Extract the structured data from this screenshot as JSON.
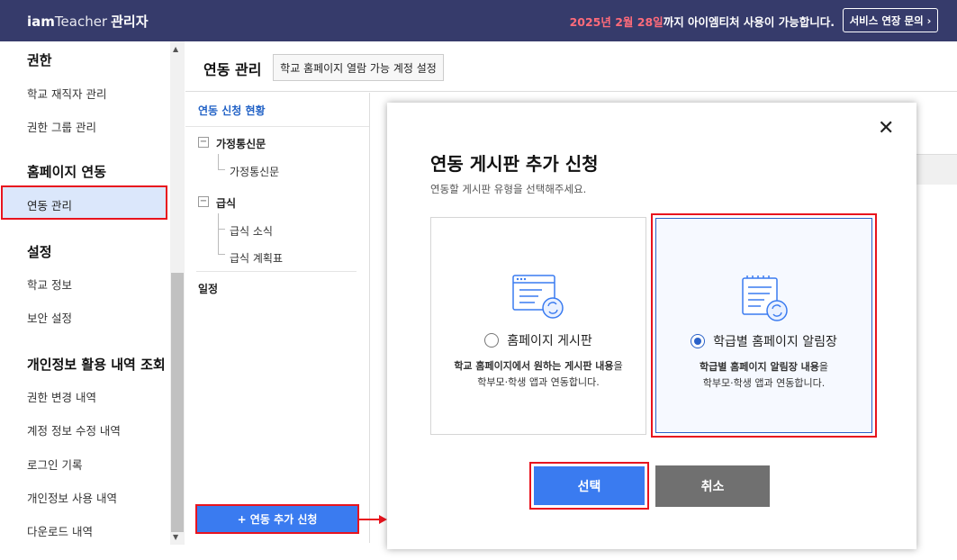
{
  "topbar": {
    "logo_brand": "iam",
    "logo_product": "Teacher",
    "logo_admin": "관리자",
    "notice_highlight": "2025년 2월 28일",
    "notice_rest": "까지 아이엠티처 사용이 가능합니다.",
    "service_button": "서비스 연장 문의 ›"
  },
  "sidebar": {
    "sections": [
      {
        "heading": "권한",
        "items": [
          "학교 재직자 관리",
          "권한 그룹 관리"
        ]
      },
      {
        "heading": "홈페이지 연동",
        "items": [
          "연동 관리"
        ]
      },
      {
        "heading": "설정",
        "items": [
          "학교 정보",
          "보안 설정"
        ]
      },
      {
        "heading": "개인정보 활용 내역 조회",
        "items": [
          "권한 변경 내역",
          "계정 정보 수정 내역",
          "로그인 기록",
          "개인정보 사용 내역",
          "다운로드 내역"
        ]
      }
    ],
    "active_item": "연동 관리"
  },
  "header": {
    "title": "연동 관리",
    "school_account_button": "학교 홈페이지 열람 가능 계정 설정"
  },
  "tree": {
    "head": "연동 신청 현황",
    "groups": [
      {
        "toggle": "−",
        "label": "가정통신문",
        "children": [
          "가정통신문"
        ]
      },
      {
        "toggle": "−",
        "label": "급식",
        "children": [
          "급식 소식",
          "급식 계획표"
        ]
      },
      {
        "label": "일정",
        "children": []
      }
    ],
    "add_button": "+ 연동 추가 신청"
  },
  "modal": {
    "close_icon": "close-icon",
    "title": "연동 게시판 추가 신청",
    "subtitle": "연동할 게시판 유형을 선택해주세요.",
    "options": [
      {
        "label": "홈페이지 게시판",
        "desc_bold": "학교 홈페이지에서 원하는 게시판 내용",
        "desc_rest": "을",
        "desc_line2": "학부모·학생 앱과 연동합니다.",
        "selected": false
      },
      {
        "label": "학급별 홈페이지 알림장",
        "desc_bold": "학급별 홈페이지 알림장 내용",
        "desc_rest": "을",
        "desc_line2": "학부모·학생 앱과 연동합니다.",
        "selected": true
      }
    ],
    "select_button": "선택",
    "cancel_button": "취소"
  },
  "colors": {
    "topbar": "#363b6b",
    "accent_blue": "#3a7bf0",
    "highlight_red": "#e8141e",
    "notice_red": "#ff6b7a"
  }
}
